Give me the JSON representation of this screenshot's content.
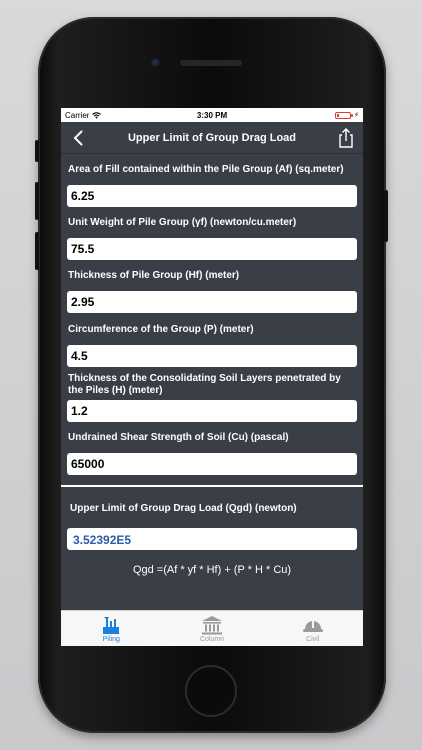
{
  "status": {
    "carrier": "Carrier",
    "time": "3:30 PM"
  },
  "nav": {
    "title": "Upper Limit of Group Drag Load",
    "back_icon": "chevron-left-icon",
    "share_icon": "share-icon"
  },
  "fields": [
    {
      "label": "Area of Fill contained within the Pile Group (Af) (sq.meter)",
      "value": "6.25"
    },
    {
      "label": "Unit Weight of Pile Group (γf) (newton/cu.meter)",
      "value": "75.5"
    },
    {
      "label": "Thickness of Pile Group (Hf) (meter)",
      "value": "2.95"
    },
    {
      "label": "Circumference of the Group (P) (meter)",
      "value": "4.5"
    },
    {
      "label": "Thickness of the Consolidating Soil Layers penetrated by the Piles (H) (meter)",
      "value": "1.2"
    },
    {
      "label": "Undrained Shear Strength of Soil (Cu) (pascal)",
      "value": "65000"
    }
  ],
  "result": {
    "label": "Upper Limit of Group Drag Load (Qgd) (newton)",
    "value": "3.52392E5"
  },
  "formula": "Qgd =(Af * yf * Hf) + (P * H * Cu)",
  "tabs": [
    {
      "label": "Piling",
      "icon": "piling-icon",
      "active": true
    },
    {
      "label": "Column",
      "icon": "column-icon",
      "active": false
    },
    {
      "label": "Civil",
      "icon": "hardhat-icon",
      "active": false
    }
  ],
  "colors": {
    "background": "#3a3e47",
    "result_text": "#2f5aa8",
    "tab_active": "#1b7fe0",
    "tab_inactive": "#9a9a9a",
    "battery": "#e53935"
  }
}
